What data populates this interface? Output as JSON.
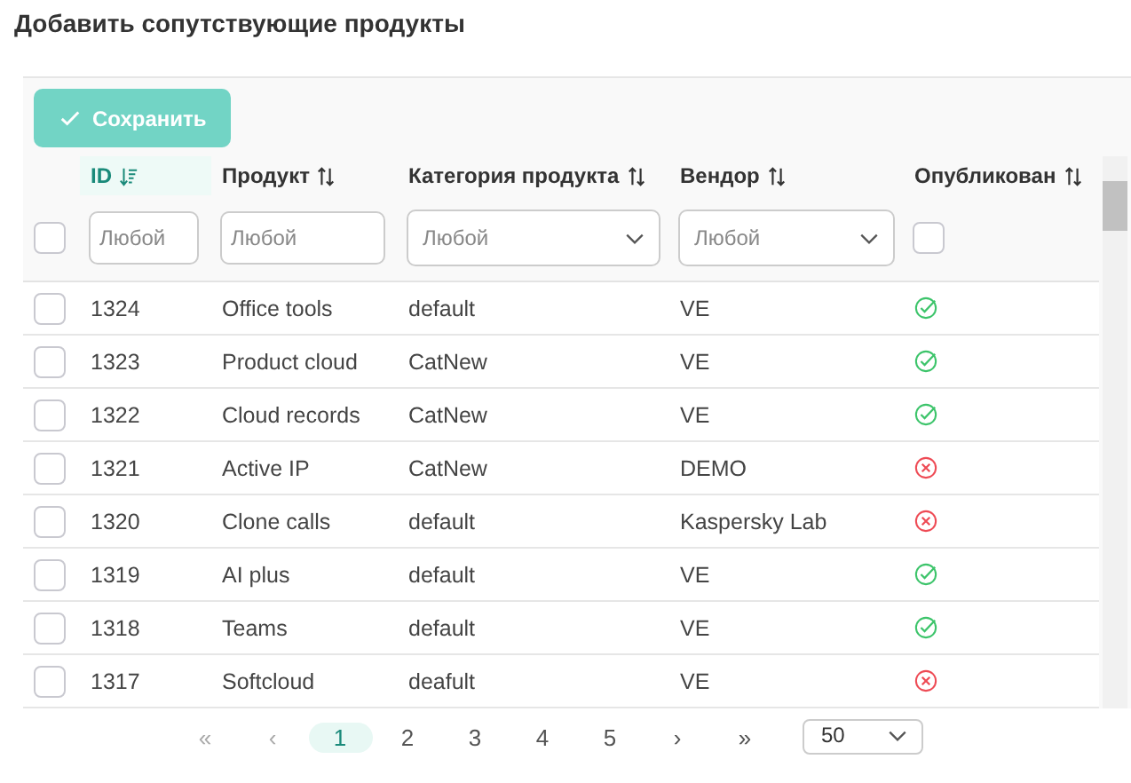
{
  "title": "Добавить сопутствующие продукты",
  "toolbar": {
    "save_button": "Сохранить",
    "disabled": true
  },
  "table": {
    "columns": [
      {
        "label": "ID",
        "sorted": true
      },
      {
        "label": "Продукт",
        "sorted": false
      },
      {
        "label": "Категория продукта",
        "sorted": false
      },
      {
        "label": "Вендор",
        "sorted": false
      },
      {
        "label": "Опубликован",
        "sorted": false
      }
    ],
    "filters": [
      {
        "kind": "text",
        "placeholder": "Любой"
      },
      {
        "kind": "text",
        "placeholder": "Любой"
      },
      {
        "kind": "select",
        "placeholder": "Любой"
      },
      {
        "kind": "select",
        "placeholder": "Любой"
      },
      {
        "kind": "checkbox",
        "checked": false
      }
    ],
    "select_all_checked": false,
    "rows": [
      {
        "checked": false,
        "id": "1324",
        "product": "Office tools",
        "category": "default",
        "vendor": "VE",
        "published": true
      },
      {
        "checked": false,
        "id": "1323",
        "product": "Product cloud",
        "category": "CatNew",
        "vendor": "VE",
        "published": true
      },
      {
        "checked": false,
        "id": "1322",
        "product": "Cloud records",
        "category": "CatNew",
        "vendor": "VE",
        "published": true
      },
      {
        "checked": false,
        "id": "1321",
        "product": "Active IP",
        "category": "CatNew",
        "vendor": "DEMO",
        "published": false
      },
      {
        "checked": false,
        "id": "1320",
        "product": "Clone calls",
        "category": "default",
        "vendor": "Kaspersky Lab",
        "published": false
      },
      {
        "checked": false,
        "id": "1319",
        "product": "AI plus",
        "category": "default",
        "vendor": "VE",
        "published": true
      },
      {
        "checked": false,
        "id": "1318",
        "product": "Teams",
        "category": "default",
        "vendor": "VE",
        "published": true
      },
      {
        "checked": false,
        "id": "1317",
        "product": "Softcloud",
        "category": "deafult",
        "vendor": "VE",
        "published": false
      }
    ]
  },
  "pagination": {
    "first": "«",
    "prev": "‹",
    "pages": [
      {
        "label": "1",
        "selected": true
      },
      {
        "label": "2",
        "selected": false
      },
      {
        "label": "3",
        "selected": false
      },
      {
        "label": "4",
        "selected": false
      },
      {
        "label": "5",
        "selected": false
      }
    ],
    "next": "›",
    "last": "»",
    "page_size": "50"
  }
}
